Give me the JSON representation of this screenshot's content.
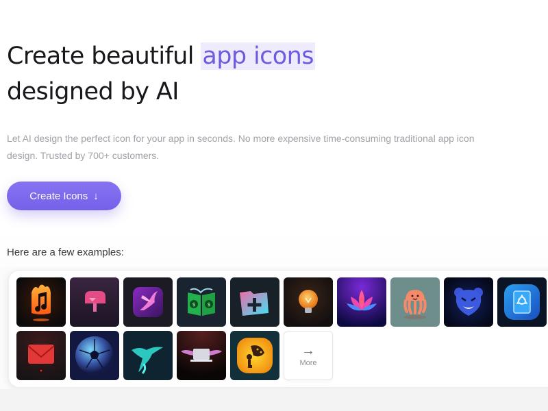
{
  "hero": {
    "title_prefix": "Create beautiful",
    "title_highlight": "app icons",
    "title_line2": "designed by AI",
    "subtitle": "Let AI design the perfect icon for your app in seconds. No more expensive time-consuming traditional app icon design. Trusted by 700+ customers.",
    "cta_label": "Create Icons",
    "cta_icon": "arrow-down-icon"
  },
  "colors": {
    "accent": "#7663ea",
    "highlight_bg": "#eeebfc",
    "text": "#17171c",
    "muted_text": "#a1a1a8"
  },
  "examples": {
    "label": "Here are a few examples:",
    "icons": [
      {
        "name": "flaming-music-note-icon"
      },
      {
        "name": "pink-mailbox-icon"
      },
      {
        "name": "purple-bird-icon"
      },
      {
        "name": "money-book-icon"
      },
      {
        "name": "folder-plus-icon"
      },
      {
        "name": "light-bulb-icon"
      },
      {
        "name": "lotus-flower-icon"
      },
      {
        "name": "jellyfish-icon"
      },
      {
        "name": "angry-bear-icon"
      },
      {
        "name": "blue-book-icon"
      },
      {
        "name": "red-envelope-icon"
      },
      {
        "name": "neon-soccer-ball-icon"
      },
      {
        "name": "teal-bird-icon"
      },
      {
        "name": "winged-laptop-icon"
      },
      {
        "name": "mushroom-person-icon"
      }
    ],
    "more_label": "More",
    "more_icon": "arrow-right-icon"
  }
}
